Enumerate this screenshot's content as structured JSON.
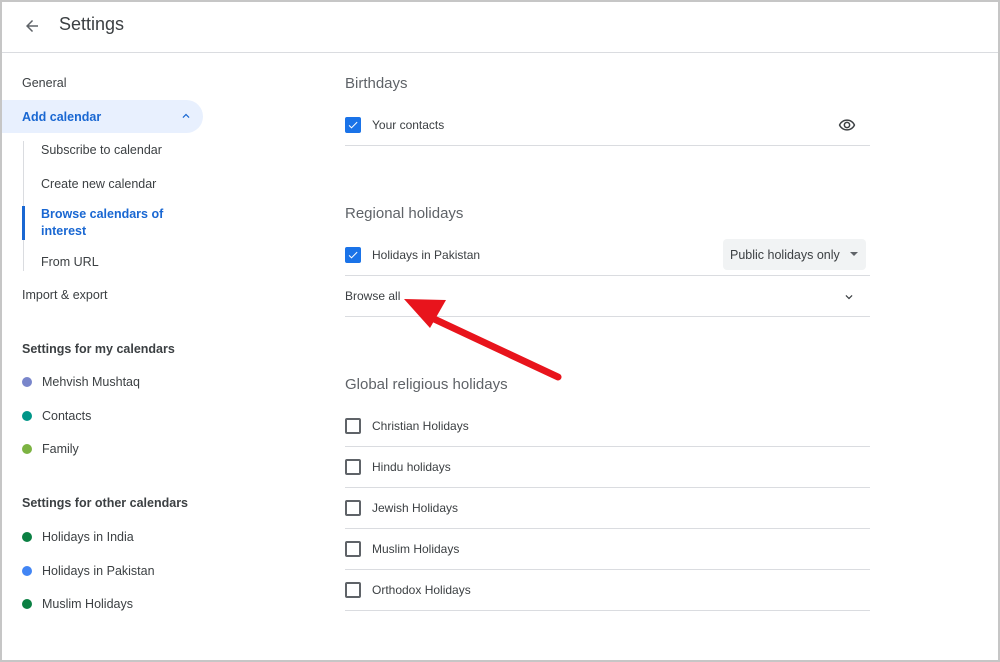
{
  "header": {
    "title": "Settings"
  },
  "nav": {
    "general": "General",
    "add_calendar": "Add calendar",
    "add_calendar_sub": [
      "Subscribe to calendar",
      "Create new calendar",
      "Browse calendars of interest",
      "From URL"
    ],
    "import_export": "Import & export",
    "my_calendars_heading": "Settings for my calendars",
    "my_calendars": [
      {
        "label": "Mehvish Mushtaq",
        "color": "#7986cb"
      },
      {
        "label": "Contacts",
        "color": "#009688"
      },
      {
        "label": "Family",
        "color": "#7cb342"
      }
    ],
    "other_calendars_heading": "Settings for other calendars",
    "other_calendars": [
      {
        "label": "Holidays in India",
        "color": "#0b8043"
      },
      {
        "label": "Holidays in Pakistan",
        "color": "#4285f4"
      },
      {
        "label": "Muslim Holidays",
        "color": "#0b8043"
      }
    ]
  },
  "main": {
    "birthdays": {
      "title": "Birthdays",
      "items": [
        {
          "label": "Your contacts",
          "checked": true,
          "icon": "eye-icon"
        }
      ]
    },
    "regional": {
      "title": "Regional holidays",
      "items": [
        {
          "label": "Holidays in Pakistan",
          "checked": true,
          "select_value": "Public holidays only"
        }
      ],
      "browse_all": "Browse all"
    },
    "religious": {
      "title": "Global religious holidays",
      "items": [
        {
          "label": "Christian Holidays",
          "checked": false
        },
        {
          "label": "Hindu holidays",
          "checked": false
        },
        {
          "label": "Jewish Holidays",
          "checked": false
        },
        {
          "label": "Muslim Holidays",
          "checked": false
        },
        {
          "label": "Orthodox Holidays",
          "checked": false
        }
      ]
    }
  },
  "colors": {
    "accent": "#1a73e8",
    "nav_active_bg": "#e8f0fe",
    "annotation": "#e8141c"
  }
}
